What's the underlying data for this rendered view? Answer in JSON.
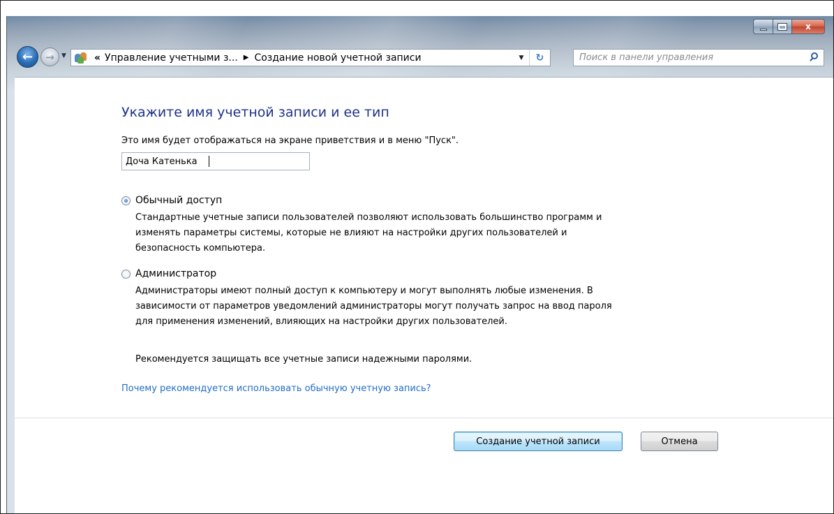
{
  "titlebar": {
    "min_glyph": "",
    "close_glyph": "x"
  },
  "nav": {
    "back_glyph": "←",
    "forward_glyph": "→",
    "address": {
      "chevron": "«",
      "crumb1": "Управление учетными з...",
      "separator": "▶",
      "crumb2": "Создание новой учетной записи",
      "dropdown_glyph": "▼",
      "refresh_glyph": "↻"
    },
    "search": {
      "placeholder": "Поиск в панели управления"
    }
  },
  "main": {
    "heading": "Укажите имя учетной записи и ее тип",
    "description": "Это имя будет отображаться на экране приветствия и в меню \"Пуск\".",
    "account_name_value": "Доча Катенька",
    "options": [
      {
        "label": "Обычный доступ",
        "checked": true,
        "description_lines": [
          "Стандартные учетные записи пользователей позволяют использовать большинство программ и",
          "изменять параметры системы, которые не влияют на настройки других пользователей и",
          "безопасность компьютера."
        ]
      },
      {
        "label": "Администратор",
        "checked": false,
        "description_lines": [
          "Администраторы имеют полный доступ к компьютеру и могут выполнять любые изменения. В",
          "зависимости от параметров уведомлений администраторы могут получать запрос на ввод пароля",
          "для применения изменений, влияющих на настройки других пользователей."
        ]
      }
    ],
    "recommendation": "Рекомендуется защищать все учетные записи надежными паролями.",
    "why_link": "Почему рекомендуется использовать обычную учетную запись?"
  },
  "buttons": {
    "create": "Создание учетной записи",
    "cancel": "Отмена"
  },
  "colors": {
    "heading": "#1e3287",
    "link": "#1f6cc7",
    "close_button": "#c3422a"
  },
  "icons": {
    "address": "users-icon",
    "search": "search-icon",
    "refresh": "refresh-icon"
  }
}
